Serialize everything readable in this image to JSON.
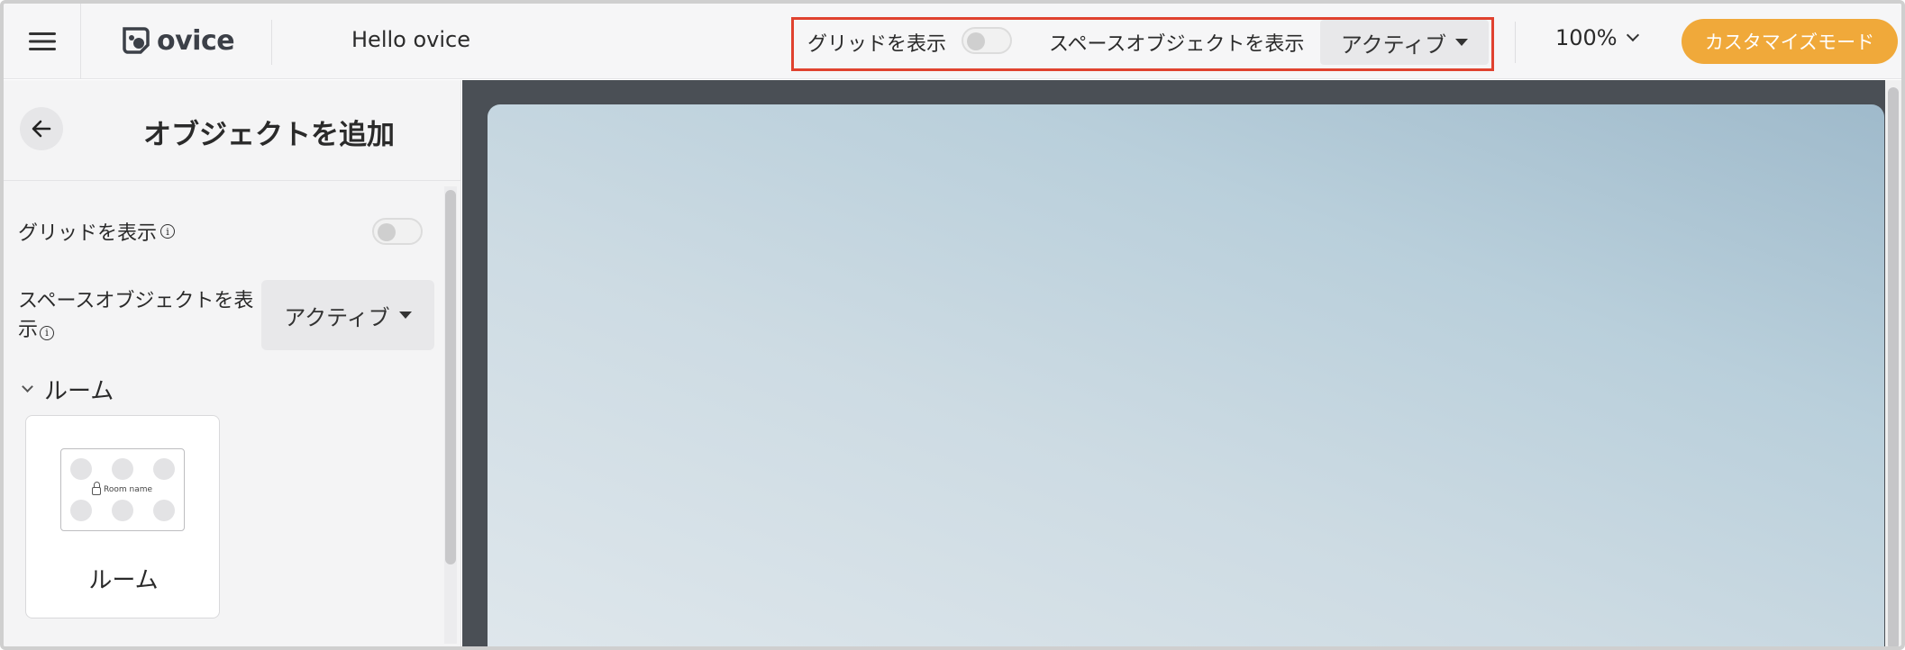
{
  "header": {
    "logo_text": "ovice",
    "space_name": "Hello ovice",
    "show_grid_label": "グリッドを表示",
    "show_space_objects_label": "スペースオブジェクトを表示",
    "space_objects_value": "アクティブ",
    "zoom": "100%",
    "customize_mode_label": "カスタマイズモード",
    "show_grid_on": false
  },
  "sidebar": {
    "title": "オブジェクトを追加",
    "show_grid_label": "グリッドを表示",
    "show_grid_on": false,
    "show_space_objects_label": "スペースオブジェクトを表示",
    "space_objects_value": "アクティブ",
    "section_title": "ルーム",
    "card": {
      "preview_room_name": "Room name",
      "label": "ルーム"
    }
  },
  "colors": {
    "accent": "#f0a93a",
    "highlight_border": "#e0422f",
    "canvas_bg": "#4a4f55"
  }
}
